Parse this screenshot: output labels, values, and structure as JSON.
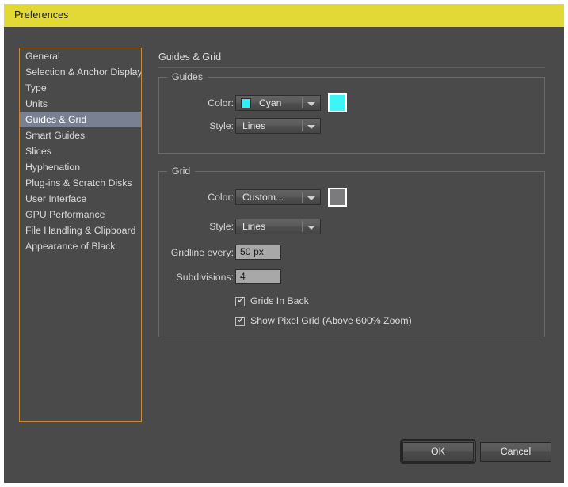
{
  "window": {
    "title": "Preferences",
    "titlebar_color": "#e2d937",
    "background_color": "#4a4a4a"
  },
  "sidebar": {
    "border_color": "#c98a3e",
    "selected_index": 4,
    "selected_color": "#788091",
    "items": [
      {
        "label": "General"
      },
      {
        "label": "Selection & Anchor Display"
      },
      {
        "label": "Type"
      },
      {
        "label": "Units"
      },
      {
        "label": "Guides & Grid"
      },
      {
        "label": "Smart Guides"
      },
      {
        "label": "Slices"
      },
      {
        "label": "Hyphenation"
      },
      {
        "label": "Plug-ins & Scratch Disks"
      },
      {
        "label": "User Interface"
      },
      {
        "label": "GPU Performance"
      },
      {
        "label": "File Handling & Clipboard"
      },
      {
        "label": "Appearance of Black"
      }
    ]
  },
  "pane": {
    "title": "Guides & Grid",
    "guides": {
      "legend": "Guides",
      "color_label": "Color:",
      "color_value": "Cyan",
      "color_swatch": "#31eff2",
      "color_chip": "#3df5f7",
      "style_label": "Style:",
      "style_value": "Lines"
    },
    "grid": {
      "legend": "Grid",
      "color_label": "Color:",
      "color_value": "Custom...",
      "color_chip": "#7b7b7e",
      "style_label": "Style:",
      "style_value": "Lines",
      "gridline_every_label": "Gridline every:",
      "gridline_every_value": "50 px",
      "subdivisions_label": "Subdivisions:",
      "subdivisions_value": "4",
      "grids_in_back_label": "Grids In Back",
      "grids_in_back_checked": true,
      "show_pixel_grid_label": "Show Pixel Grid (Above 600% Zoom)",
      "show_pixel_grid_checked": true,
      "checkmark": "✓"
    }
  },
  "footer": {
    "ok_label": "OK",
    "cancel_label": "Cancel"
  }
}
